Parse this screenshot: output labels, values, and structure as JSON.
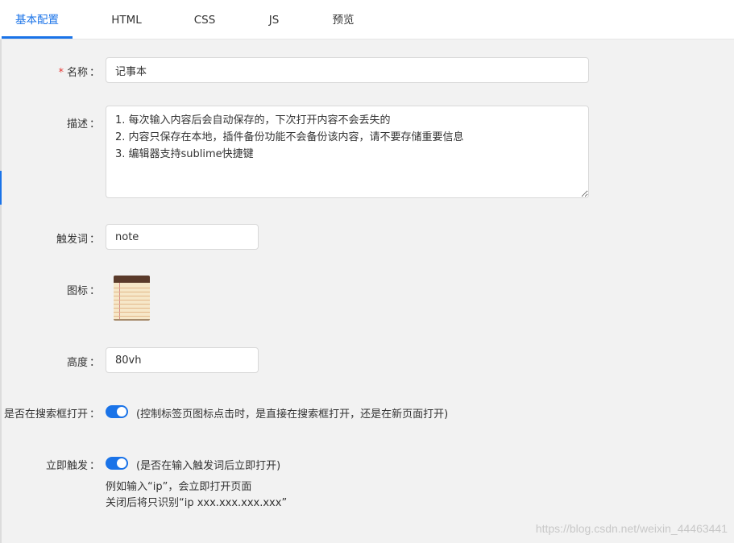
{
  "tabs": [
    "基本配置",
    "HTML",
    "CSS",
    "JS",
    "预览"
  ],
  "form": {
    "name": {
      "required_mark": "*",
      "label": "名称",
      "value": "记事本"
    },
    "description": {
      "label": "描述",
      "value": "1. 每次输入内容后会自动保存的，下次打开内容不会丢失的\n2. 内容只保存在本地，插件备份功能不会备份该内容，请不要存储重要信息\n3. 编辑器支持sublime快捷键"
    },
    "trigger": {
      "label": "触发词",
      "value": "note"
    },
    "icon": {
      "label": "图标",
      "icon_name": "notepad-icon"
    },
    "height": {
      "label": "高度",
      "value": "80vh"
    },
    "open_in_searchbox": {
      "label": "是否在搜索框打开",
      "enabled": true,
      "hint": "(控制标签页图标点击时，是直接在搜索框打开，还是在新页面打开)"
    },
    "instant_trigger": {
      "label": "立即触发",
      "enabled": true,
      "hint": "(是否在输入触发词后立即打开)",
      "note_line1": "例如输入“ip”，会立即打开页面",
      "note_line2": "关闭后将只识别“ip xxx.xxx.xxx.xxx”"
    },
    "colon": "："
  },
  "watermark": "https://blog.csdn.net/weixin_44463441",
  "colors": {
    "accent": "#1a73e8",
    "required": "#e53935",
    "background": "#f2f2f2"
  }
}
